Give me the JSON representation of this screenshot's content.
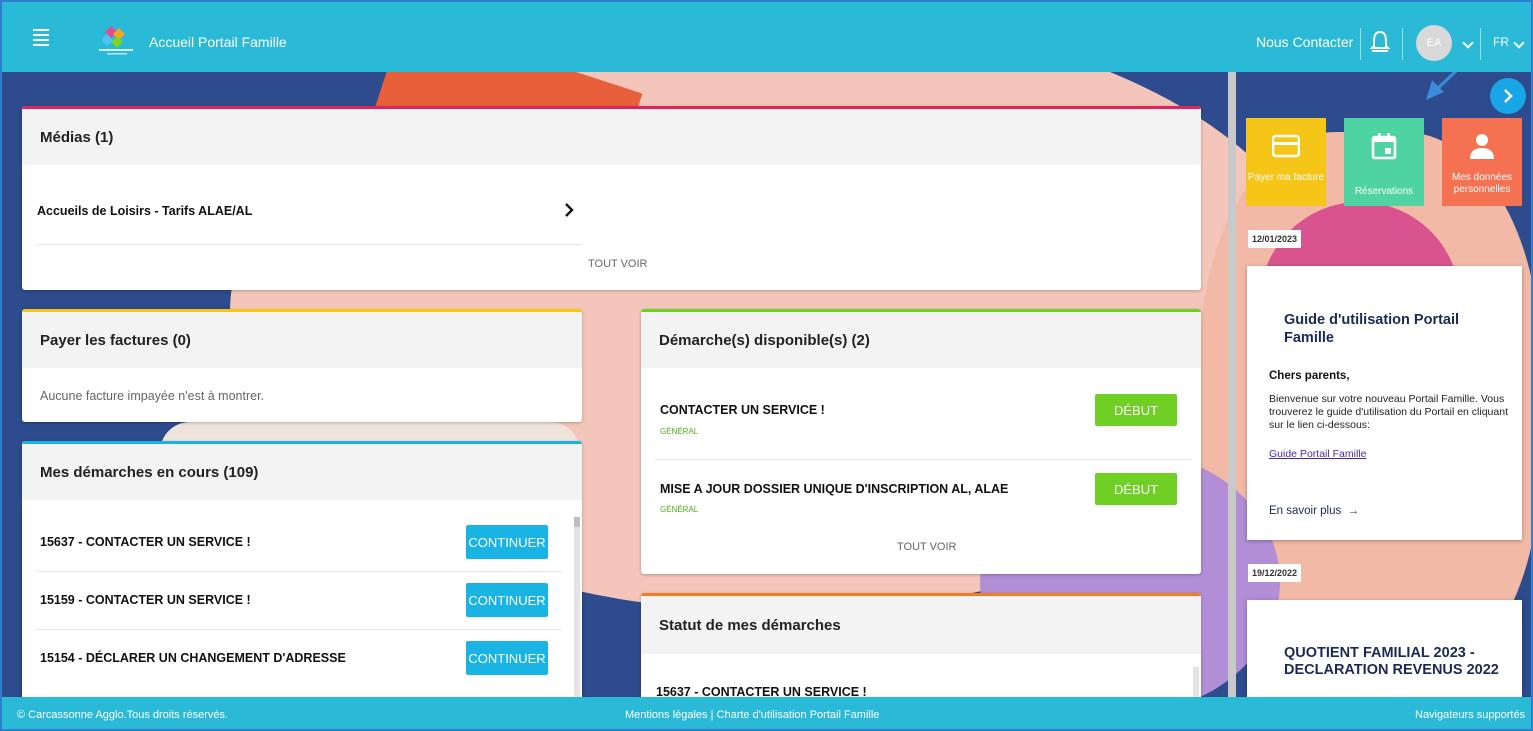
{
  "header": {
    "title": "Accueil Portail Famille",
    "contact": "Nous Contacter",
    "avatar_initials": "EA",
    "language": "FR"
  },
  "medias": {
    "title": "Médias (1)",
    "item": "Accueils de Loisirs - Tarifs ALAE/AL",
    "see_all": "TOUT VOIR"
  },
  "factures": {
    "title": "Payer les factures (0)",
    "empty": "Aucune facture impayée n'est à montrer."
  },
  "demarches_en_cours": {
    "title": "Mes démarches en cours (109)",
    "items": [
      {
        "label": "15637 - CONTACTER UN SERVICE !",
        "button": "CONTINUER"
      },
      {
        "label": "15159 - CONTACTER UN SERVICE !",
        "button": "CONTINUER"
      },
      {
        "label": "15154 - DÉCLARER UN CHANGEMENT D'ADRESSE",
        "button": "CONTINUER"
      }
    ]
  },
  "demarches_disponibles": {
    "title": "Démarche(s) disponible(s) (2)",
    "items": [
      {
        "label": "CONTACTER UN SERVICE !",
        "category": "GÉNÉRAL",
        "button": "DÉBUT"
      },
      {
        "label": "MISE A JOUR DOSSIER UNIQUE D'INSCRIPTION AL, ALAE",
        "category": "GÉNÉRAL",
        "button": "DÉBUT"
      }
    ],
    "see_all": "TOUT VOIR"
  },
  "statut": {
    "title": "Statut de mes démarches",
    "first_item": "15637 - CONTACTER UN SERVICE !"
  },
  "quick_tiles": [
    {
      "label": "Payer ma facture",
      "icon": "credit-card-icon",
      "color": "#f5c518"
    },
    {
      "label": "Réservations",
      "icon": "calendar-icon",
      "color": "#4fd3a2"
    },
    {
      "label": "Mes données personnelles",
      "icon": "person-icon",
      "color": "#f47252"
    }
  ],
  "news": [
    {
      "date": "12/01/2023",
      "title": "Guide d'utilisation Portail Famille",
      "greeting": "Chers parents,",
      "body": "Bienvenue sur votre nouveau Portail Famille. Vous trouverez le guide d'utilisation du Portail en cliquant sur le lien ci-dessous:",
      "link": "Guide Portail Famille",
      "more": "En savoir plus"
    },
    {
      "date": "19/12/2022",
      "title": "QUOTIENT FAMILIAL 2023 - DECLARATION REVENUS 2022"
    }
  ],
  "footer": {
    "copyright": "© Carcassonne Agglo.Tous droits réservés.",
    "links": "Mentions légales | Charte d'utilisation Portail Famille",
    "browsers": "Navigateurs supportés"
  },
  "colors": {
    "topbar": "#2bb9d8",
    "continue_button": "#19b3e4",
    "start_button": "#6fcf24",
    "medias_accent": "#e0245e",
    "factures_accent": "#f5c518",
    "en_cours_accent": "#19b3e4",
    "disponibles_accent": "#6fcf24",
    "statut_accent": "#f47b20"
  }
}
